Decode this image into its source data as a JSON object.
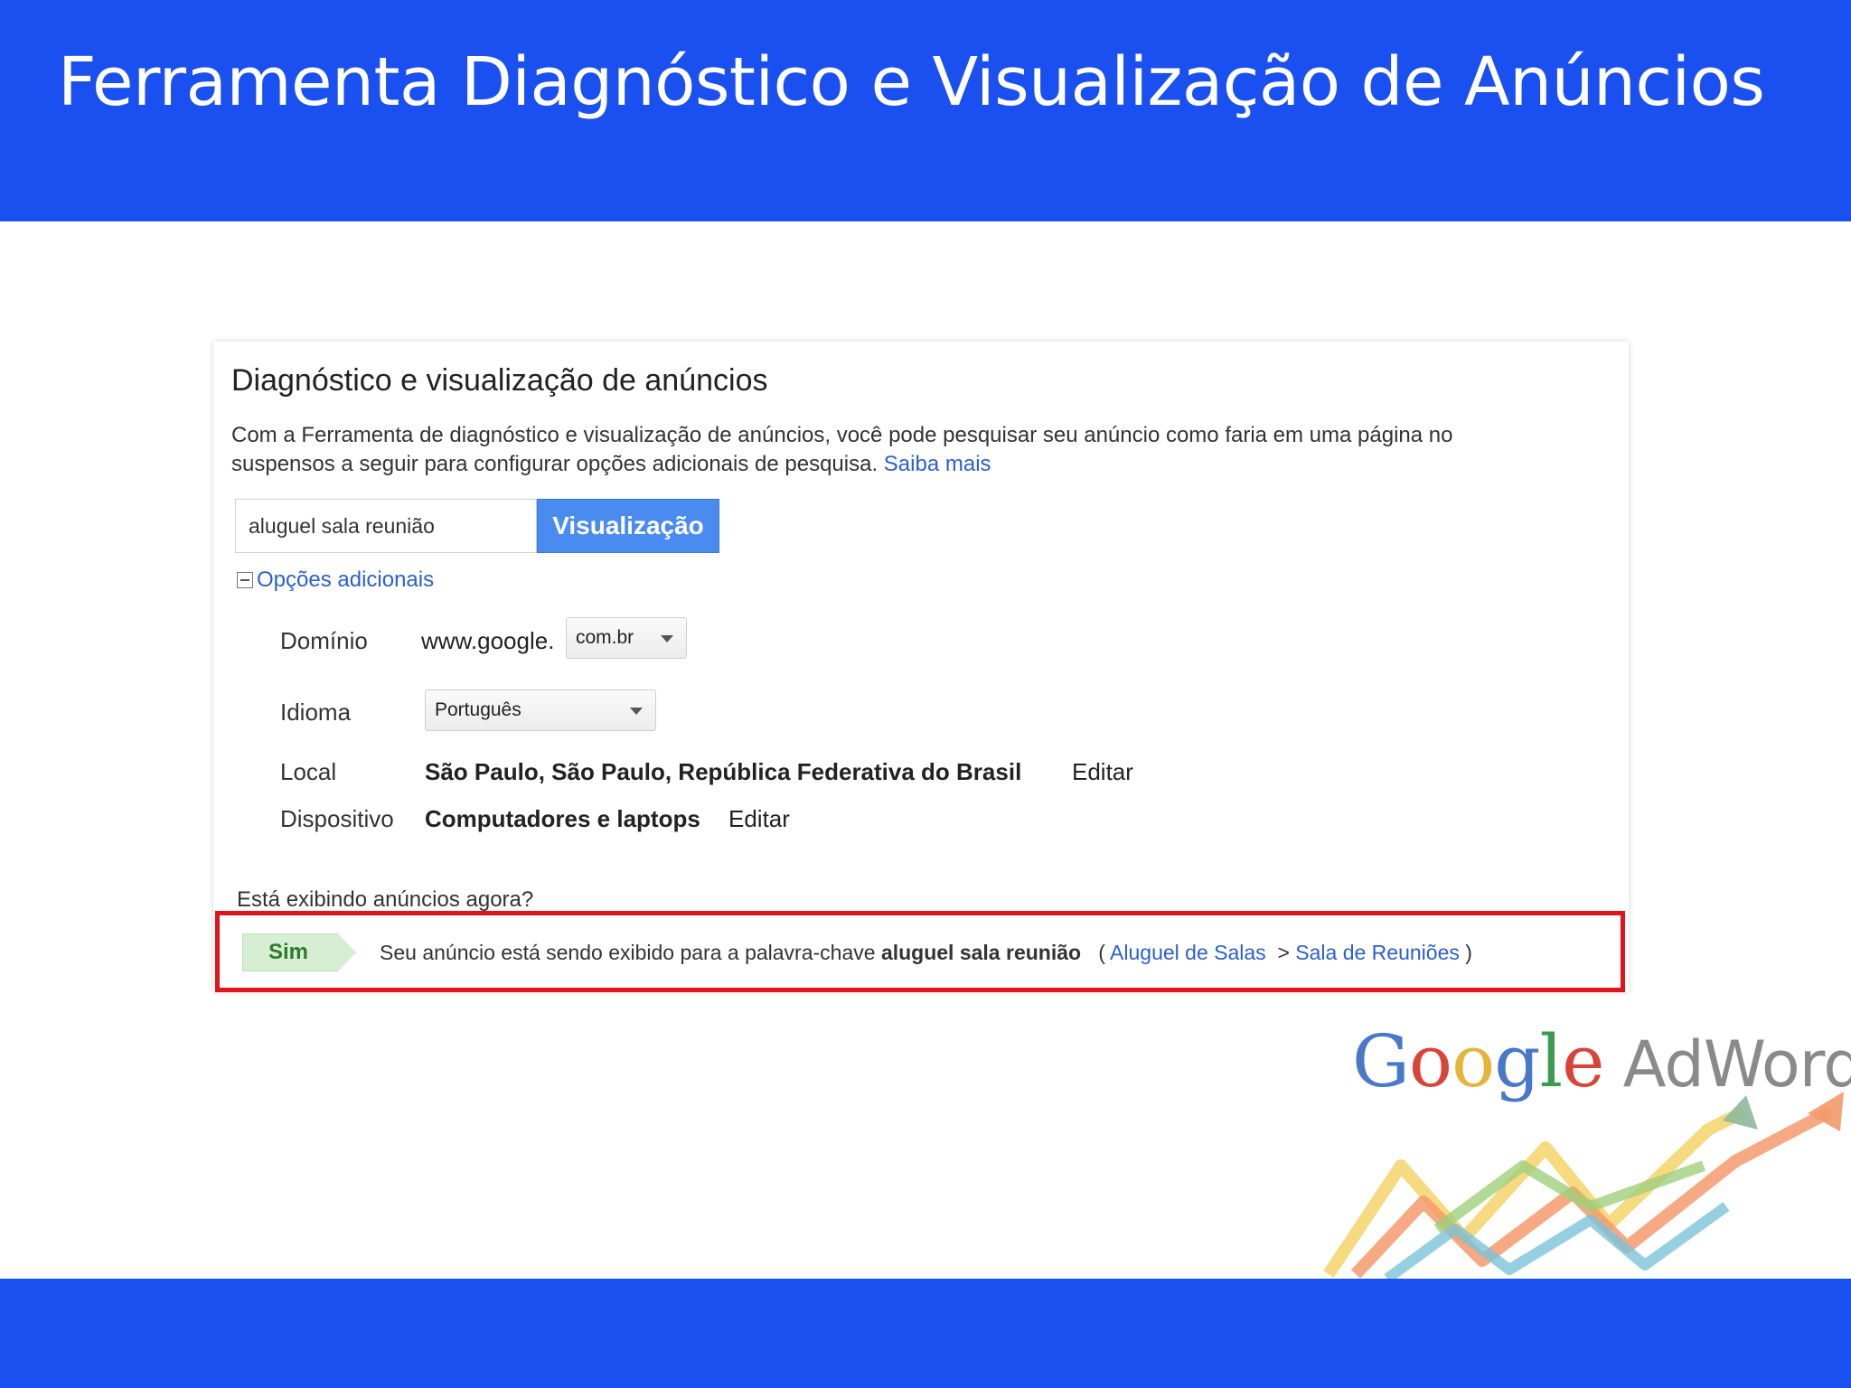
{
  "slide": {
    "title": "Ferramenta Diagnóstico e  Visualização de Anúncios"
  },
  "panel": {
    "title": "Diagnóstico e visualização de anúncios",
    "description_line1": "Com a Ferramenta de diagnóstico e visualização de anúncios, você pode pesquisar seu anúncio como faria em uma página no",
    "description_line2": "suspensos a seguir para configurar opções adicionais de pesquisa.",
    "learn_more_link": "Saiba mais",
    "search_value": "aluguel sala reunião",
    "preview_button": "Visualização",
    "options_toggle": "Opções adicionais",
    "domain_label": "Domínio",
    "domain_prefix": "www.google.",
    "domain_select": "com.br",
    "language_label": "Idioma",
    "language_select": "Português",
    "location_label": "Local",
    "location_value": "São Paulo, São Paulo, República Federativa do Brasil",
    "location_edit": "Editar",
    "device_label": "Dispositivo",
    "device_value": "Computadores e laptops",
    "device_edit": "Editar",
    "question": "Está exibindo anúncios agora?",
    "status_badge": "Sim",
    "result_prefix": "Seu anúncio está sendo exibido para a palavra-chave",
    "result_keyword": "aluguel sala reunião",
    "paren_open": "(",
    "campaign_link": "Aluguel de Salas",
    "separator": ">",
    "adgroup_link": "Sala de Reuniões",
    "paren_close": ")"
  },
  "logo": {
    "text": "Google AdWords",
    "letters": [
      "G",
      "o",
      "o",
      "g",
      "l",
      "e"
    ],
    "adwords": "AdWords",
    "colors": {
      "blue": "#4a78c9",
      "red": "#d8443a",
      "yellow": "#e6b43a",
      "green": "#3c9a4e",
      "gray": "#888888"
    }
  },
  "colors": {
    "banner": "#1a4ff0",
    "highlight": "#e0141c",
    "link": "#2a5fd1",
    "button": "#4a8bf0"
  }
}
